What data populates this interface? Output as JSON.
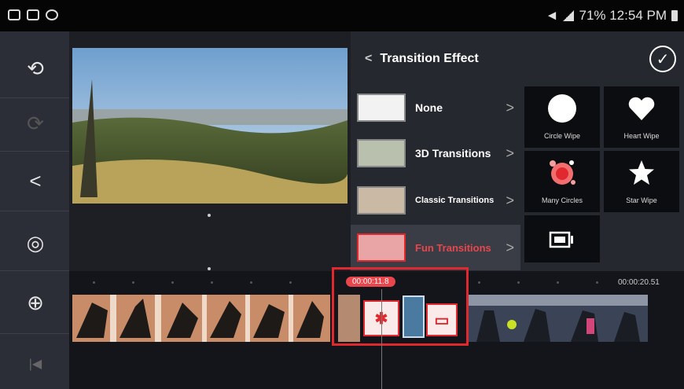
{
  "status_bar": {
    "icons_left": [
      "notification-icon",
      "gallery-icon",
      "settings-icon"
    ],
    "text_right": "71% 12:54 PM"
  },
  "toolbar": {
    "items": [
      {
        "name": "undo-icon",
        "glyph": "⟲"
      },
      {
        "name": "redo-icon",
        "glyph": "⟳"
      },
      {
        "name": "share-icon",
        "glyph": "<"
      },
      {
        "name": "preview-eye-icon",
        "glyph": "◎"
      },
      {
        "name": "split-icon",
        "glyph": "⊕"
      },
      {
        "name": "skip-start-icon",
        "glyph": "|◀"
      }
    ]
  },
  "panel": {
    "back_glyph": "<",
    "title": "Transition Effect",
    "confirm_glyph": "✓",
    "categories": [
      {
        "label": "None",
        "active": false
      },
      {
        "label": "3D Transitions",
        "active": false
      },
      {
        "label": "Classic Transitions",
        "active": false
      },
      {
        "label": "Fun Transitions",
        "active": true
      }
    ],
    "chevron": ">",
    "effects": [
      {
        "label": "Circle Wipe",
        "icon": "circle-icon"
      },
      {
        "label": "Heart Wipe",
        "icon": "heart-icon"
      },
      {
        "label": "Many Circles",
        "icon": "many-circles-icon"
      },
      {
        "label": "Star Wipe",
        "icon": "star-icon"
      },
      {
        "label": "",
        "icon": "screen-icon"
      }
    ]
  },
  "timeline": {
    "current_time": "00:00:11.8",
    "end_time": "00:00:20.51"
  },
  "colors": {
    "accent": "#e8464c",
    "highlight": "#e0282f",
    "panel_bg": "#26282f",
    "toolbar_bg": "#2b2e36"
  }
}
